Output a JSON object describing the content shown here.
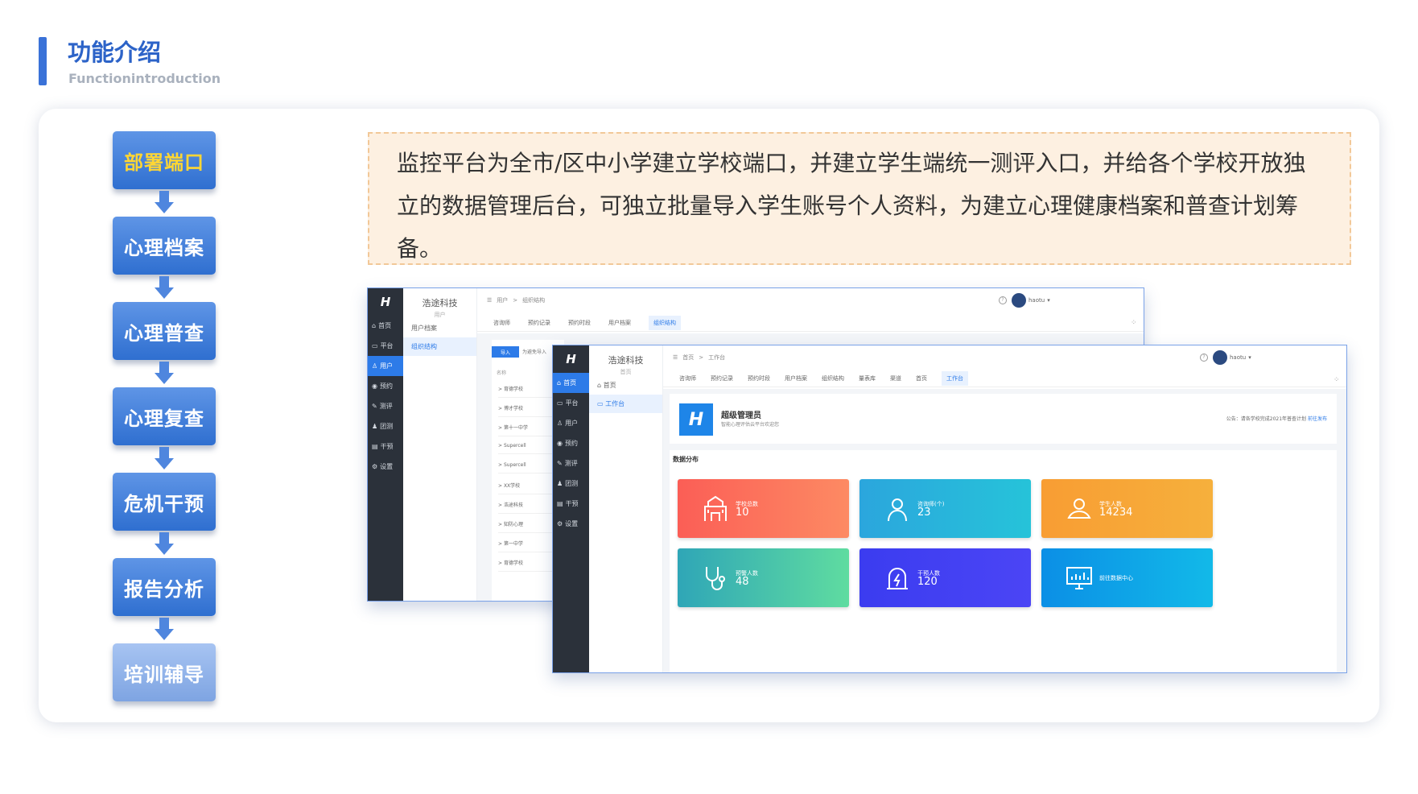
{
  "header": {
    "title": "功能介绍",
    "subtitle": "Functionintroduction"
  },
  "flow": {
    "steps": [
      "部署端口",
      "心理档案",
      "心理普查",
      "心理复查",
      "危机干预",
      "报告分析",
      "培训辅导"
    ]
  },
  "description": "监控平台为全市/区中小学建立学校端口，并建立学生端统一测评入口，并给各个学校开放独立的数据管理后台，可独立批量导入学生账号个人资料，为建立心理健康档案和普查计划筹备。",
  "colors": {
    "accent": "#3a72d8",
    "sidebar": "#2b313a",
    "active": "#2d7be8",
    "tile_school": "#fb6d5a",
    "tile_counselor": "#28b4dc",
    "tile_student": "#f7a234",
    "tile_warning": "#37c3a8",
    "tile_intervene": "#3d3ef0",
    "tile_center": "#0fa6e6"
  },
  "back_window": {
    "logo": "H",
    "sidebar": [
      "首页",
      "平台",
      "用户",
      "预约",
      "测评",
      "团测",
      "干预",
      "设置"
    ],
    "brand": "浩途科技",
    "brand_sub": "用户",
    "submenu": [
      "用户档案",
      "组织结构"
    ],
    "breadcrumb": [
      "用户",
      "组织结构"
    ],
    "tabs": [
      "咨询师",
      "预约记录",
      "预约时段",
      "用户档案",
      "组织结构"
    ],
    "user": "haotu",
    "import_button": "导入",
    "import_tip": "为避免导入",
    "list_header": "名称",
    "list": [
      "育德学校",
      "博才学校",
      "第十一中学",
      "Supercell",
      "Supercell",
      "XX学校",
      "浩途科技",
      "知防心理",
      "第一中学",
      "育德学校"
    ]
  },
  "front_window": {
    "logo": "H",
    "sidebar": [
      "首页",
      "平台",
      "用户",
      "预约",
      "测评",
      "团测",
      "干预",
      "设置"
    ],
    "brand": "浩途科技",
    "brand_sub": "首页",
    "submenu": [
      "首页",
      "工作台"
    ],
    "breadcrumb": [
      "首页",
      "工作台"
    ],
    "tabs": [
      "咨询师",
      "预约记录",
      "预约时段",
      "用户档案",
      "组织结构",
      "量表库",
      "渠道",
      "首页",
      "工作台"
    ],
    "user": "haotu",
    "welcome": {
      "name": "超级管理员",
      "sub": "智能心理评估云平台欢迎您",
      "notice": "公告：请各学校完成2021年普查计划",
      "notice_link": "前往发布"
    },
    "data_title": "数据分布",
    "tiles": [
      {
        "label": "学校总数",
        "value": "10",
        "icon": "school-icon"
      },
      {
        "label": "咨询师(个)",
        "value": "23",
        "icon": "person-icon"
      },
      {
        "label": "学生人数",
        "value": "14234",
        "icon": "student-icon"
      },
      {
        "label": "预警人数",
        "value": "48",
        "icon": "stethoscope-icon"
      },
      {
        "label": "干预人数",
        "value": "120",
        "icon": "alarm-icon"
      },
      {
        "label": "前往数据中心",
        "value": "",
        "icon": "monitor-chart-icon"
      }
    ]
  }
}
